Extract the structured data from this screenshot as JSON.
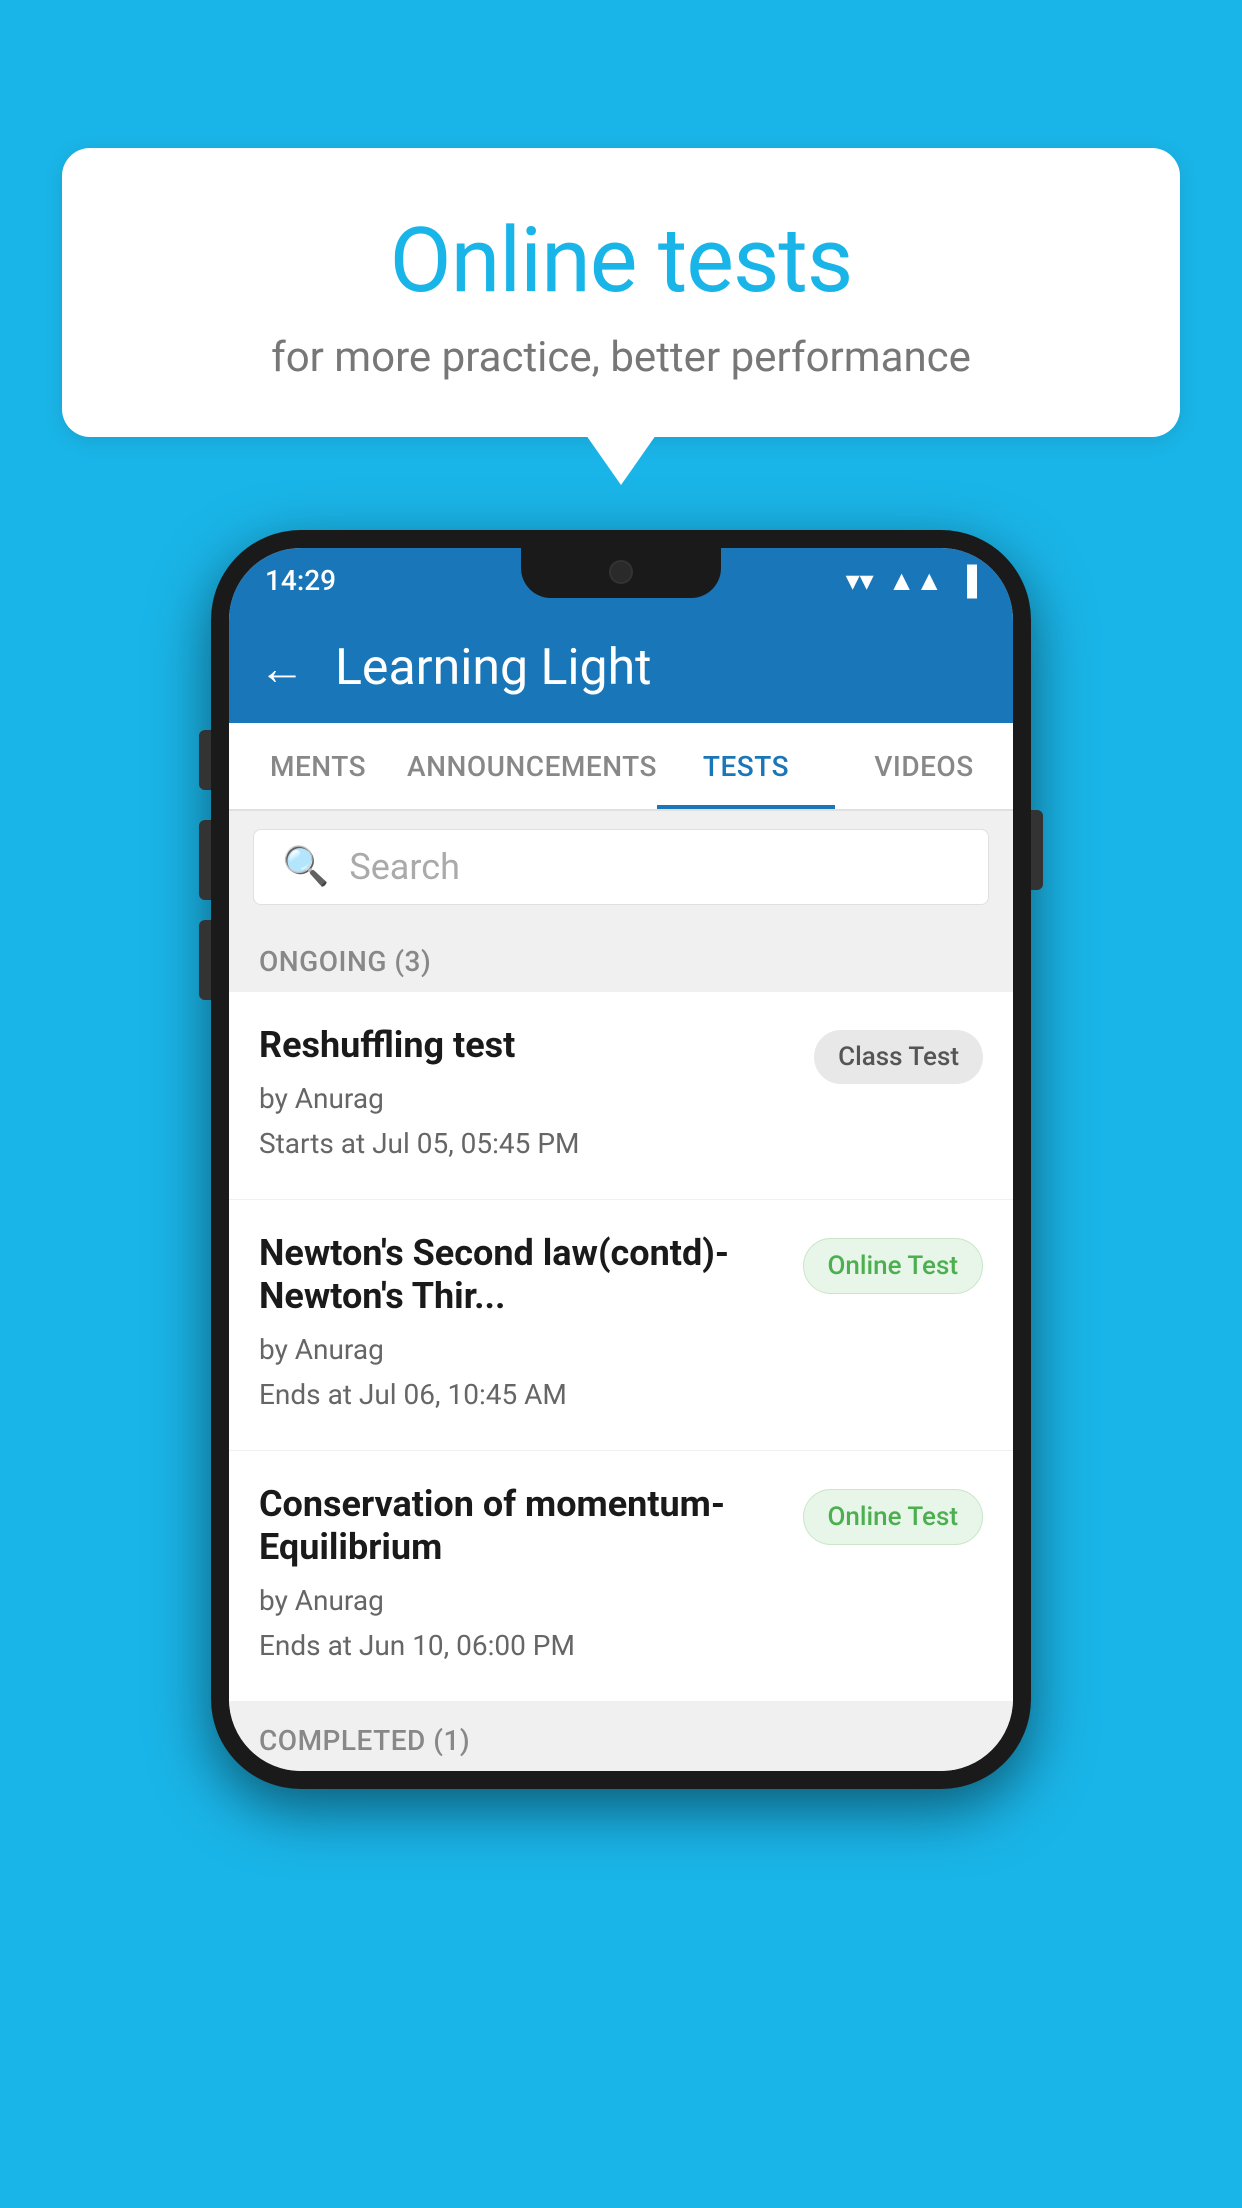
{
  "background": {
    "color": "#1ab5e8"
  },
  "bubble": {
    "title": "Online tests",
    "subtitle": "for more practice, better performance"
  },
  "phone": {
    "status_bar": {
      "time": "14:29"
    },
    "app_bar": {
      "title": "Learning Light",
      "back_label": "←"
    },
    "tabs": [
      {
        "label": "MENTS",
        "active": false
      },
      {
        "label": "ANNOUNCEMENTS",
        "active": false
      },
      {
        "label": "TESTS",
        "active": true
      },
      {
        "label": "VIDEOS",
        "active": false
      }
    ],
    "search": {
      "placeholder": "Search"
    },
    "sections": [
      {
        "header": "ONGOING (3)",
        "items": [
          {
            "name": "Reshuffling test",
            "by": "by Anurag",
            "time": "Starts at  Jul 05, 05:45 PM",
            "badge": "Class Test",
            "badge_type": "class"
          },
          {
            "name": "Newton's Second law(contd)-Newton's Thir...",
            "by": "by Anurag",
            "time": "Ends at  Jul 06, 10:45 AM",
            "badge": "Online Test",
            "badge_type": "online"
          },
          {
            "name": "Conservation of momentum-Equilibrium",
            "by": "by Anurag",
            "time": "Ends at  Jun 10, 06:00 PM",
            "badge": "Online Test",
            "badge_type": "online"
          }
        ]
      }
    ],
    "completed_header": "COMPLETED (1)"
  }
}
